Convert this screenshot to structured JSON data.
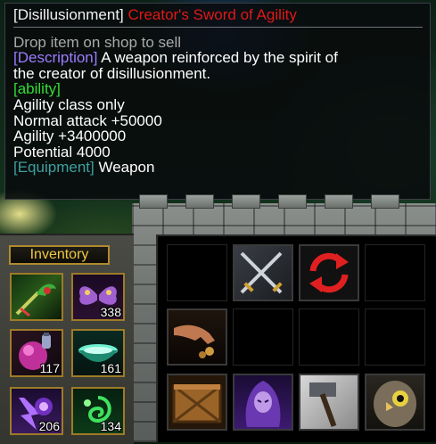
{
  "tooltip": {
    "title_bracket": "[Disillusionment]",
    "title_name": "Creator's Sword of Agility",
    "sell_hint": "Drop item on shop to sell",
    "description_label": "[Description]",
    "description_line1": " A weapon reinforced by the spirit of",
    "description_line2": "the creator of disillusionment.",
    "ability_label": "[ability]",
    "stats": [
      "Agility class only",
      "Normal attack +50000",
      "Agility +3400000",
      "Potential 4000"
    ],
    "equipment_label": "[Equipment]",
    "equipment_value": " Weapon"
  },
  "inventory": {
    "title": "Inventory",
    "slots": [
      {
        "icon": "green-dragon-scepter-icon",
        "count": ""
      },
      {
        "icon": "purple-butterfly-icon",
        "count": "338"
      },
      {
        "icon": "pink-orb-potion-icon",
        "count": "117"
      },
      {
        "icon": "teal-bowl-icon",
        "count": "161"
      },
      {
        "icon": "purple-energy-icon",
        "count": "206"
      },
      {
        "icon": "green-swirl-icon",
        "count": "134"
      }
    ]
  },
  "command_card": {
    "slots": [
      {
        "icon": "crossed-swords-icon"
      },
      {
        "icon": "red-cycle-arrows-icon"
      },
      {
        "icon": "grabbing-hand-icon"
      },
      {
        "icon": "wooden-crate-icon"
      },
      {
        "icon": "purple-hooded-figure-icon"
      },
      {
        "icon": "war-hammer-icon"
      },
      {
        "icon": "owl-icon"
      }
    ]
  },
  "colors": {
    "title_red": "#e01818",
    "label_purple": "#9c7cff",
    "label_green": "#33dd33",
    "label_teal": "#3fa0a0",
    "inventory_gold": "#f2c640"
  }
}
